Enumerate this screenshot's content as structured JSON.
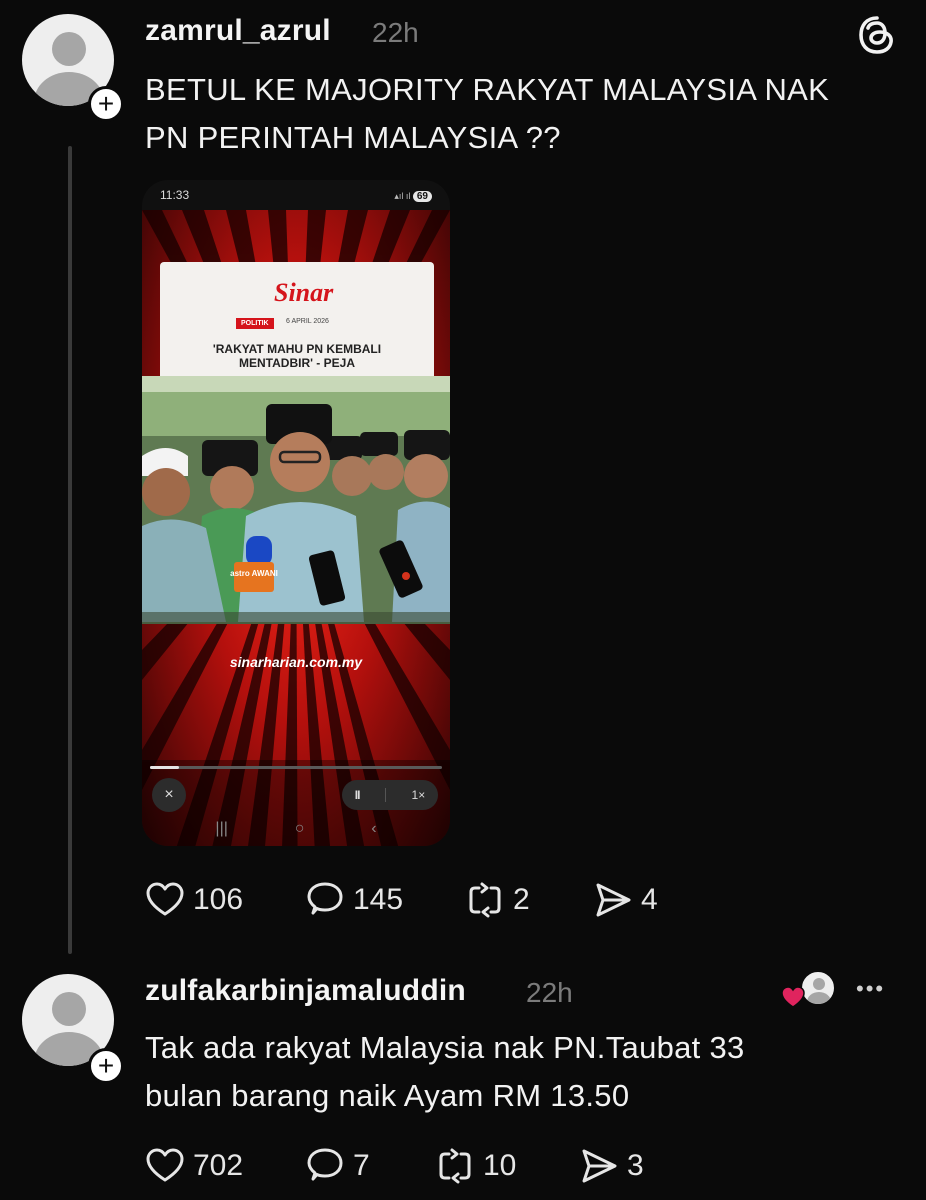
{
  "post": {
    "username": "zamrul_azrul",
    "time": "22h",
    "text_line1": "BETUL KE MAJORITY RAKYAT MALAYSIA NAK",
    "text_line2": "PN PERINTAH MALAYSIA ??",
    "media": {
      "status_time": "11:33",
      "battery": "69",
      "logo": "Sinar",
      "category": "POLITIK",
      "date": "6 APRIL 2026",
      "headline_line1": "'RAKYAT MAHU PN KEMBALI",
      "headline_line2": "MENTADBIR' - PEJA",
      "mic_label": "astro AWANI",
      "site": "sinarharian.com.my",
      "close_icon": "×",
      "pause_icon": "II",
      "speed": "1×",
      "progress": 0.1
    },
    "likes": "106",
    "replies": "145",
    "reposts": "2",
    "shares": "4"
  },
  "reply": {
    "username": "zulfakarbinjamaluddin",
    "time": "22h",
    "text_line1": "Tak ada rakyat Malaysia nak PN.Taubat 33",
    "text_line2": "bulan barang naik Ayam RM 13.50",
    "likes": "702",
    "replies": "7",
    "reposts": "10",
    "shares": "3",
    "more": "•••"
  },
  "icons": {
    "app": "threads-logo-icon",
    "like": "heart-outline-icon",
    "reply": "speech-bubble-icon",
    "repost": "repost-arrows-icon",
    "share": "send-icon",
    "follow": "plus-icon"
  },
  "colors": {
    "background": "#0a0a0a",
    "text": "#f2f2f2",
    "muted": "#7b7b7b",
    "heart_red": "#e0245e",
    "sinar_red": "#d5141b"
  }
}
